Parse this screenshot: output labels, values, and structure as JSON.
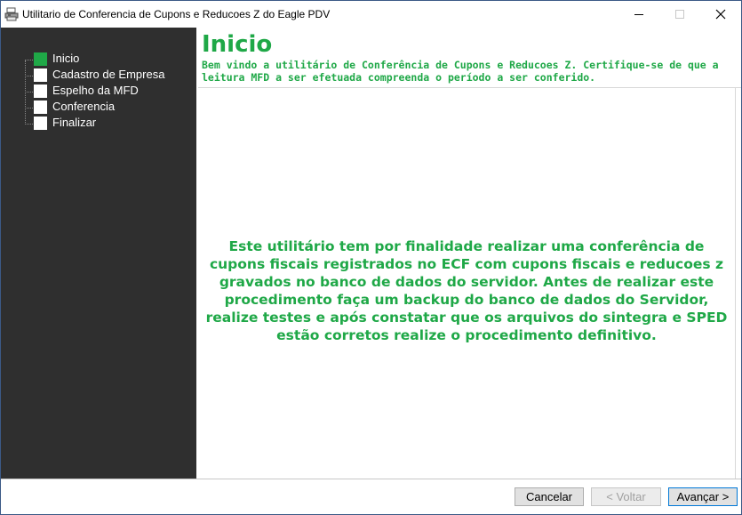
{
  "window": {
    "title": "Utilitario de Conferencia de Cupons e Reducoes Z do Eagle PDV"
  },
  "sidebar": {
    "items": [
      {
        "label": "Inicio",
        "active": true
      },
      {
        "label": "Cadastro de Empresa",
        "active": false
      },
      {
        "label": "Espelho da MFD",
        "active": false
      },
      {
        "label": "Conferencia",
        "active": false
      },
      {
        "label": "Finalizar",
        "active": false
      }
    ]
  },
  "header": {
    "title": "Inicio",
    "subtitle": "Bem vindo a utilitário de Conferência de Cupons e Reducoes Z. Certifique-se de que a leitura MFD a ser efetuada compreenda o período a ser conferido."
  },
  "content": {
    "text": "Este utilitário tem por finalidade realizar uma conferência de cupons fiscais registrados no ECF com cupons fiscais e reducoes z gravados no banco de dados do servidor. Antes de realizar este procedimento faça um backup do banco de dados do Servidor, realize testes e após constatar que os arquivos do sintegra e SPED estão corretos realize o procedimento definitivo."
  },
  "footer": {
    "cancel_label": "Cancelar",
    "back_label": "< Voltar",
    "next_label": "Avançar >"
  },
  "colors": {
    "accent": "#1fa847",
    "sidebar_bg": "#2f2f2f"
  },
  "icons": {
    "app": "printer-icon",
    "minimize": "minimize-icon",
    "maximize": "maximize-icon",
    "close": "close-icon"
  }
}
